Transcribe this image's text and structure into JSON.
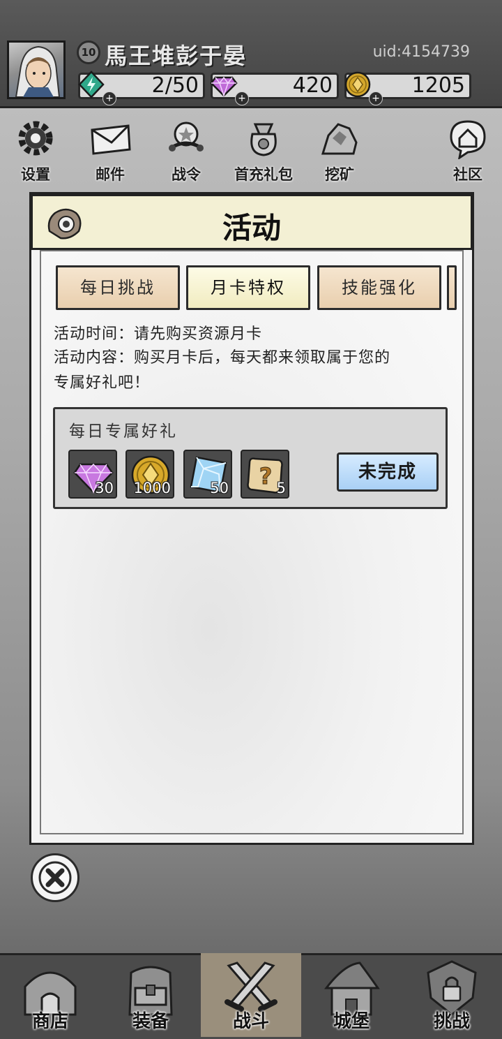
{
  "player": {
    "level": "10",
    "name": "馬王堆彭于晏",
    "uid": "uid:4154739"
  },
  "resources": [
    {
      "icon": "energy-icon",
      "value": "2/50"
    },
    {
      "icon": "diamond-icon",
      "value": "420"
    },
    {
      "icon": "coin-icon",
      "value": "1205"
    }
  ],
  "menu": [
    {
      "icon": "gear-icon",
      "label": "设置"
    },
    {
      "icon": "mail-icon",
      "label": "邮件"
    },
    {
      "icon": "battle-pass-icon",
      "label": "战令"
    },
    {
      "icon": "gift-bag-icon",
      "label": "首充礼包"
    },
    {
      "icon": "mining-icon",
      "label": "挖矿"
    },
    {
      "icon": "community-icon",
      "label": "社区"
    }
  ],
  "modal": {
    "title": "活动",
    "tabs": [
      {
        "label": "每日挑战",
        "active": false
      },
      {
        "label": "月卡特权",
        "active": true
      },
      {
        "label": "技能强化",
        "active": false
      }
    ],
    "activity_time": "活动时间：请先购买资源月卡",
    "activity_content_line1": "活动内容：购买月卡后，每天都来领取属于您的",
    "activity_content_line2": "专属好礼吧！",
    "reward_title": "每日专属好礼",
    "rewards": [
      {
        "icon": "diamond-icon",
        "count": "30"
      },
      {
        "icon": "coin-icon",
        "count": "1000"
      },
      {
        "icon": "crystal-icon",
        "count": "50"
      },
      {
        "icon": "mystery-scroll-icon",
        "count": "5"
      }
    ],
    "status_button": "未完成"
  },
  "nav": [
    {
      "icon": "shop-icon",
      "label": "商店",
      "active": false
    },
    {
      "icon": "equipment-icon",
      "label": "装备",
      "active": false
    },
    {
      "icon": "swords-icon",
      "label": "战斗",
      "active": true
    },
    {
      "icon": "castle-icon",
      "label": "城堡",
      "active": false
    },
    {
      "icon": "challenge-icon",
      "label": "挑战",
      "active": false
    }
  ],
  "colors": {
    "tab_active": "#f1ecc0",
    "tab_inactive": "#e9cfae",
    "status_button": "#a9d0f5"
  }
}
